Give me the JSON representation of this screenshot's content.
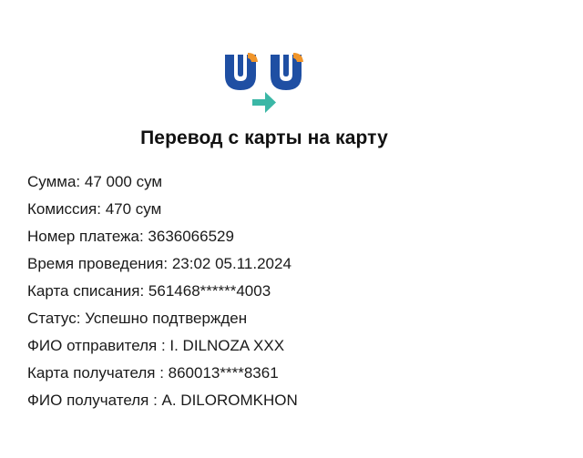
{
  "brand": {
    "logo_icon": "uzcard-transfer-logo-icon",
    "colors": {
      "blue": "#1f4fa3",
      "orange": "#f0952a",
      "teal": "#3bb7a6"
    }
  },
  "receipt": {
    "title": "Перевод с карты на карту",
    "rows": [
      {
        "label": "Сумма",
        "separator": ": ",
        "value": "47 000 сум"
      },
      {
        "label": "Комиссия",
        "separator": ": ",
        "value": "470 сум"
      },
      {
        "label": "Номер платежа",
        "separator": ": ",
        "value": "3636066529"
      },
      {
        "label": "Время проведения",
        "separator": ": ",
        "value": "23:02 05.11.2024"
      },
      {
        "label": "Карта списания",
        "separator": ": ",
        "value": "561468******4003"
      },
      {
        "label": "Статус",
        "separator": ": ",
        "value": "Успешно подтвержден"
      },
      {
        "label": "ФИО отправителя",
        "separator": " : ",
        "value": "I. DILNOZA XXX"
      },
      {
        "label": "Карта получателя",
        "separator": " : ",
        "value": "860013****8361"
      },
      {
        "label": "ФИО получателя",
        "separator": " : ",
        "value": "A. DILOROMKHON"
      }
    ]
  }
}
